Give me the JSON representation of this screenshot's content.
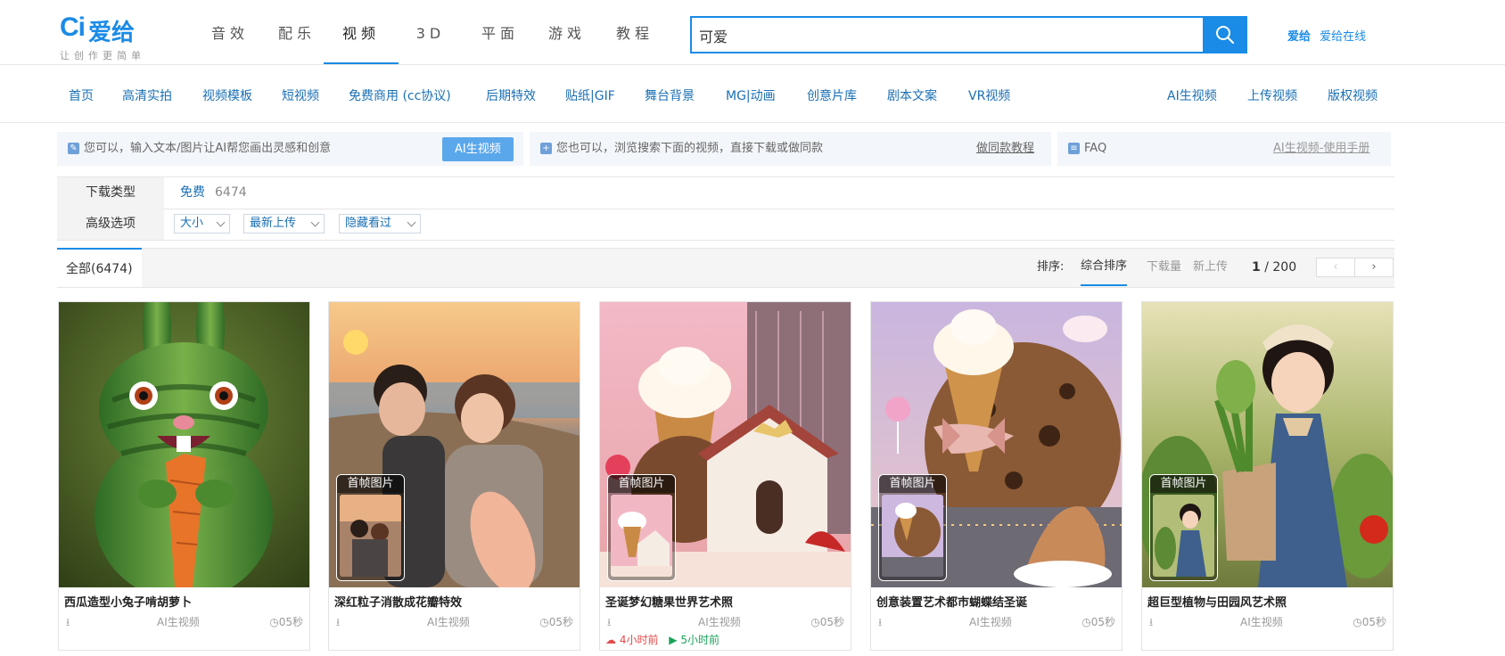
{
  "logo": {
    "mark": "Ci",
    "name": "爱给",
    "slogan": "让创作更简单"
  },
  "top_nav": [
    "音效",
    "配乐",
    "视频",
    "3D",
    "平面",
    "游戏",
    "教程"
  ],
  "active_top_nav": "视频",
  "search": {
    "value": "可爱",
    "icon": "search-icon"
  },
  "partner": {
    "logo": "爱给",
    "label": "爱给在线"
  },
  "sub_nav_left": [
    "首页",
    "高清实拍",
    "视频模板",
    "短视频",
    "免费商用 (cc协议)",
    "后期特效",
    "贴纸|GIF",
    "舞台背景",
    "MG|动画",
    "创意片库",
    "剧本文案",
    "VR视频"
  ],
  "sub_nav_right": [
    "AI生视频",
    "上传视频",
    "版权视频"
  ],
  "tips": {
    "tip1_text": "您可以，输入文本/图片让AI帮您画出灵感和创意",
    "tip1_button": "AI生视频",
    "tip2_text": "您也可以，浏览搜索下面的视频，直接下载或做同款",
    "tip2_link": "做同款教程",
    "tip3_text": "FAQ",
    "tip3_link": "AI生视频-使用手册"
  },
  "filters": {
    "download_type_label": "下载类型",
    "download_type_value": "免费",
    "download_type_count": "6474",
    "advanced_label": "高级选项",
    "dropdowns": [
      "大小",
      "最新上传",
      "隐藏看过"
    ]
  },
  "tab_bar": {
    "all_tab": "全部(6474)",
    "sort_label": "排序:",
    "sort_options": [
      "综合排序",
      "下载量",
      "新上传"
    ],
    "active_sort": "综合排序",
    "page_current": "1",
    "page_total": "200"
  },
  "cards": [
    {
      "title": "西瓜造型小兔子啃胡萝卜",
      "category": "AI生视频",
      "duration": "05秒",
      "badge": ""
    },
    {
      "title": "深红粒子消散成花瓣特效",
      "category": "AI生视频",
      "duration": "05秒",
      "badge": "首帧图片"
    },
    {
      "title": "圣诞梦幻糖果世界艺术照",
      "category": "AI生视频",
      "duration": "05秒",
      "badge": "首帧图片",
      "time_a": "4小时前",
      "time_b": "5小时前"
    },
    {
      "title": "创意装置艺术都市蝴蝶结圣诞",
      "category": "AI生视频",
      "duration": "05秒",
      "badge": "首帧图片"
    },
    {
      "title": "超巨型植物与田园风艺术照",
      "category": "AI生视频",
      "duration": "05秒",
      "badge": "首帧图片"
    }
  ],
  "colors": {
    "accent": "#1a8be6",
    "link": "#1a6fb4",
    "hot": "#e24b4b",
    "fresh": "#1aa35a"
  }
}
